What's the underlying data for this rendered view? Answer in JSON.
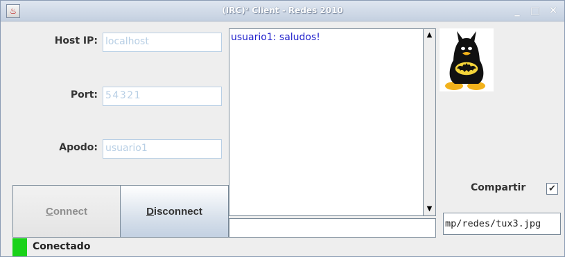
{
  "window": {
    "title": "(IRC)² Client - Redes 2010",
    "app_icon": "java-cup-icon",
    "controls": [
      "minimize",
      "maximize",
      "close"
    ]
  },
  "connection": {
    "host_label": "Host IP:",
    "host_value": "localhost",
    "port_label": "Port:",
    "port_value": "54321",
    "nick_label": "Apodo:",
    "nick_value": "usuario1"
  },
  "buttons": {
    "connect_mnemonic": "C",
    "connect_rest": "onnect",
    "disconnect_mnemonic": "D",
    "disconnect_rest": "isconnect"
  },
  "chat": {
    "messages": [
      "usuario1: saludos!"
    ],
    "input_value": ""
  },
  "share": {
    "label": "Compartir",
    "checked": true,
    "file_path": "mp/redes/tux3.jpg"
  },
  "status": {
    "text": "Conectado",
    "color": "#19d219"
  },
  "colors": {
    "field_text": "#b8cfe5",
    "chat_text": "#2222cc"
  }
}
